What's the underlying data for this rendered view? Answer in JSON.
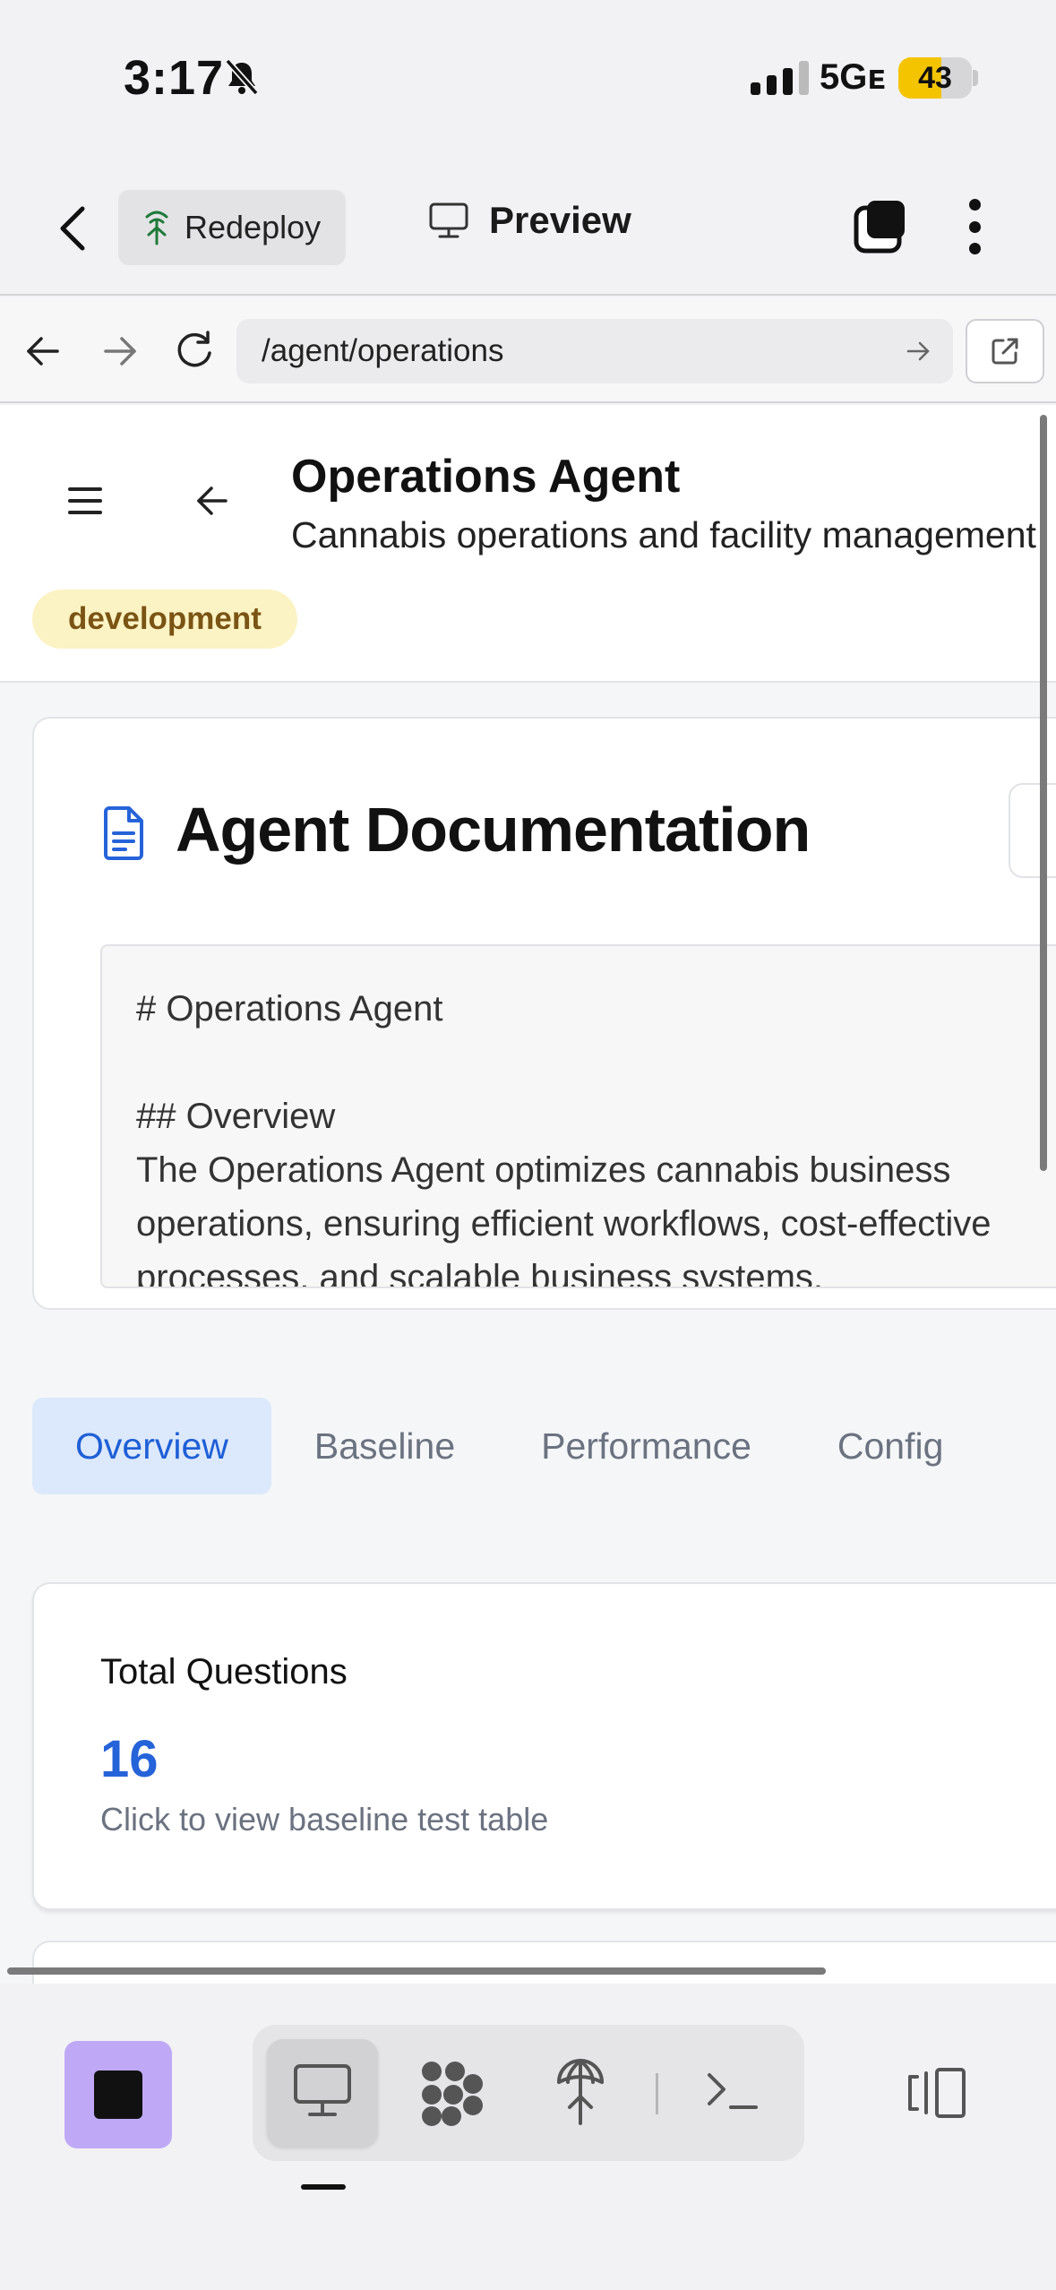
{
  "status_bar": {
    "time": "3:17",
    "network": "5Gᴇ",
    "battery": "43",
    "battery_level": 0.43
  },
  "app_bar": {
    "redeploy_label": "Redeploy",
    "preview_label": "Preview"
  },
  "browser": {
    "url": "/agent/operations"
  },
  "agent": {
    "title": "Operations Agent",
    "subtitle": "Cannabis operations and facility management",
    "status_badge": "development"
  },
  "documentation": {
    "title": "Agent Documentation",
    "content": "# Operations Agent\n\n## Overview\nThe Operations Agent optimizes cannabis business\noperations, ensuring efficient workflows, cost-effective\nprocesses, and scalable business systems."
  },
  "tabs": [
    {
      "label": "Overview",
      "active": true
    },
    {
      "label": "Baseline",
      "active": false
    },
    {
      "label": "Performance",
      "active": false
    },
    {
      "label": "Config",
      "active": false
    }
  ],
  "stats": {
    "label": "Total Questions",
    "value": "16",
    "hint": "Click to view baseline test table"
  },
  "colors": {
    "accent_blue": "#2563d9",
    "badge_bg": "#fcf3c4",
    "badge_text": "#7a5414",
    "stop_button": "#bfa9f6",
    "battery_yellow": "#f5c400"
  },
  "icons": {
    "redeploy": "antenna-tree-icon",
    "preview": "monitor-icon",
    "toolbar": [
      "monitor-icon",
      "puzzle-grid-icon",
      "deploy-icon",
      "terminal-icon",
      "split-view-icon"
    ]
  }
}
